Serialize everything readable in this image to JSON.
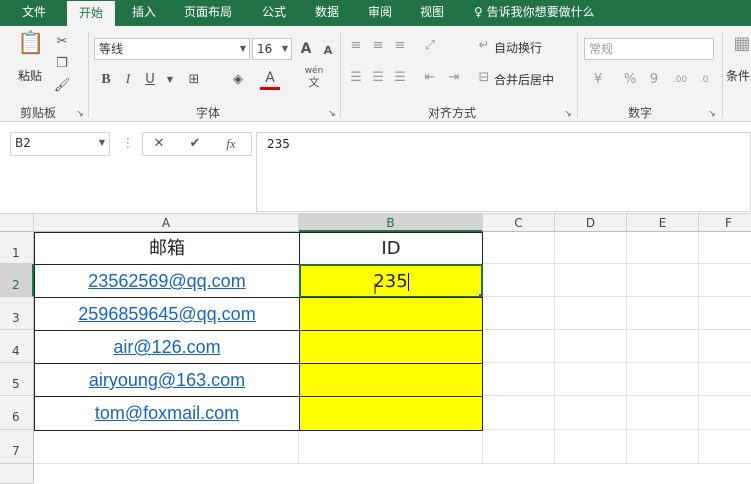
{
  "tabs": [
    "文件",
    "开始",
    "插入",
    "页面布局",
    "公式",
    "数据",
    "审阅",
    "视图"
  ],
  "tell_me": "告诉我你想要做什么",
  "ribbon": {
    "paste_label": "粘贴",
    "clipboard_label": "剪贴板",
    "font_name": "等线",
    "font_size": "16",
    "font_group_label": "字体",
    "bold": "B",
    "italic": "I",
    "underline": "U",
    "grow_font": "A",
    "shrink_font": "A",
    "font_color": "A",
    "phonetic_top": "wén",
    "phonetic_bottom": "文",
    "wrap_text": "自动换行",
    "merge_center": "合并后居中",
    "align_group_label": "对齐方式",
    "number_format": "常规",
    "percent": "%",
    "comma": "9",
    "number_group_label": "数字",
    "conditional_label": "条件"
  },
  "formula_bar": {
    "name_box": "B2",
    "cancel": "✕",
    "enter": "✔",
    "fx": "fx",
    "value": "235"
  },
  "columns": [
    "A",
    "B",
    "C",
    "D",
    "E",
    "F"
  ],
  "rows": [
    "1",
    "2",
    "3",
    "4",
    "5",
    "6",
    "7"
  ],
  "cells": {
    "A1": "邮箱",
    "B1": "ID",
    "A2": "23562569@qq.com",
    "A3": "2596859645@qq.com",
    "A4": "air@126.com",
    "A5": "airyoung@163.com",
    "A6": "tom@foxmail.com",
    "B2": "235"
  },
  "colors": {
    "accent": "#217346",
    "highlight": "#ffff00",
    "link": "#1565c0"
  }
}
